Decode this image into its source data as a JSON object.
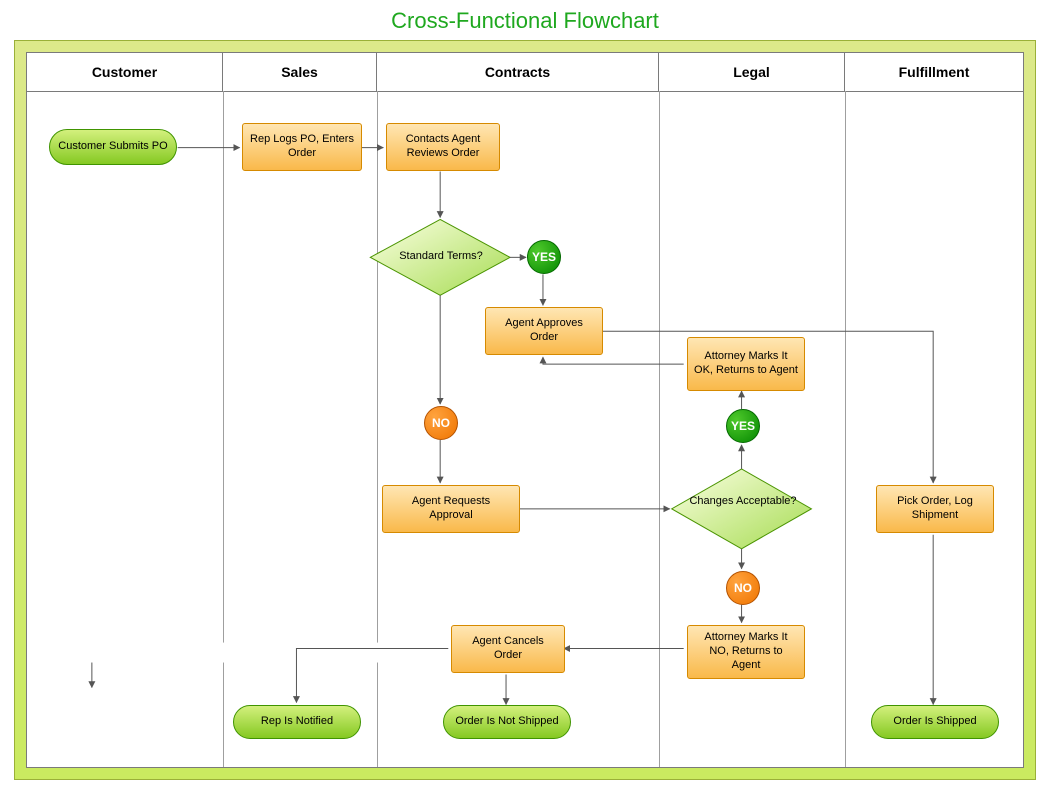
{
  "title": "Cross-Functional Flowchart",
  "lanes": {
    "customer": "Customer",
    "sales": "Sales",
    "contracts": "Contracts",
    "legal": "Legal",
    "fulfillment": "Fulfillment"
  },
  "nodes": {
    "customer_submits_po": "Customer Submits PO",
    "rep_logs_po": "Rep Logs PO, Enters Order",
    "review_order": "Contacts Agent Reviews Order",
    "standard_terms": "Standard Terms?",
    "agent_approves": "Agent Approves Order",
    "agent_requests": "Agent Requests Approval",
    "changes_acceptable": "Changes Acceptable?",
    "attorney_ok": "Attorney Marks It OK, Returns to Agent",
    "attorney_no": "Attorney Marks It NO, Returns to Agent",
    "agent_cancels": "Agent Cancels Order",
    "rep_notified": "Rep Is Notified",
    "order_not_shipped": "Order Is Not Shipped",
    "pick_order": "Pick Order, Log Shipment",
    "order_shipped": "Order Is Shipped"
  },
  "labels": {
    "yes": "YES",
    "no": "NO"
  }
}
